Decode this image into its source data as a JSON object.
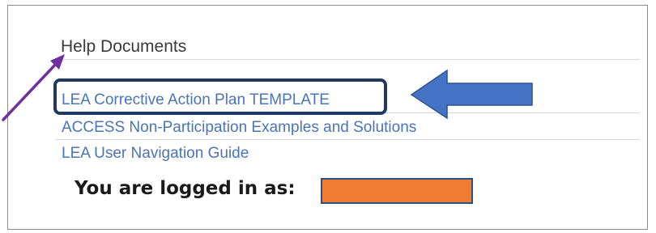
{
  "help_panel": {
    "heading": "Help Documents",
    "links": [
      "LEA Corrective Action Plan TEMPLATE",
      "ACCESS Non-Participation Examples and Solutions",
      "LEA User Navigation Guide"
    ]
  },
  "login_status": {
    "label": "You are logged in as:",
    "redaction_color": "#ee7d31"
  },
  "annotations": {
    "highlight_color": "#1f3864",
    "block_arrow_color": "#4472c4",
    "pointer_arrow_color": "#7030a0"
  }
}
